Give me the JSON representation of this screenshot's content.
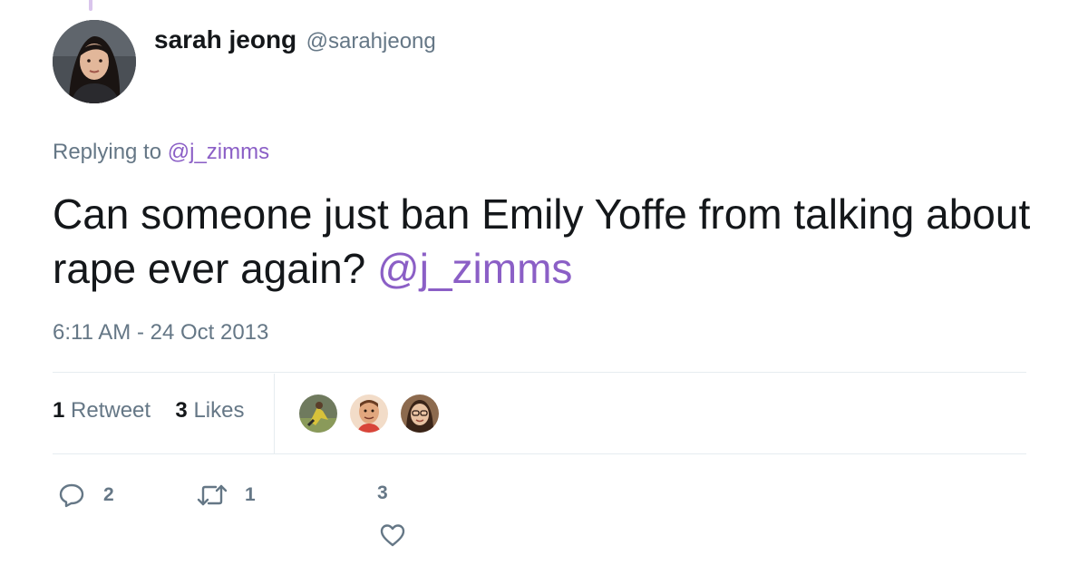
{
  "tweet": {
    "display_name": "sarah jeong",
    "handle": "@sarahjeong",
    "replying_prefix": "Replying to",
    "replying_to": "@j_zimms",
    "text": "Can someone just ban Emily Yoffe from talking about rape ever again?",
    "text_mention": "@j_zimms",
    "timestamp": "6:11 AM - 24 Oct 2013"
  },
  "stats": {
    "retweet_count": "1",
    "retweet_label": "Retweet",
    "like_count": "3",
    "like_label": "Likes"
  },
  "actions": {
    "reply_count": "2",
    "retweet_count": "1",
    "like_count": "3"
  },
  "colors": {
    "mention": "#8b5fc6",
    "muted": "#657786",
    "text": "#14171a"
  },
  "icons": {
    "reply": "reply-icon",
    "retweet": "retweet-icon",
    "like": "heart-icon"
  }
}
